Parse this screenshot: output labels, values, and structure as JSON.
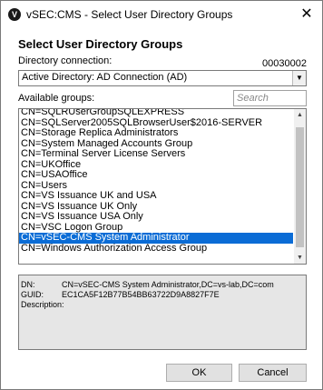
{
  "window": {
    "title": "vSEC:CMS - Select User Directory Groups",
    "close_glyph": "✕"
  },
  "heading": "Select User Directory Groups",
  "directory": {
    "label": "Directory connection:",
    "count": "00030002",
    "selected": "Active Directory: AD Connection (AD)"
  },
  "groups": {
    "label": "Available groups:",
    "search_placeholder": "Search",
    "items": [
      "CN=SQLRUserGroupSQLEXPRESS",
      "CN=SQLServer2005SQLBrowserUser$2016-SERVER",
      "CN=Storage Replica Administrators",
      "CN=System Managed Accounts Group",
      "CN=Terminal Server License Servers",
      "CN=UKOffice",
      "CN=USAOffice",
      "CN=Users",
      "CN=VS Issuance UK and USA",
      "CN=VS Issuance UK Only",
      "CN=VS Issuance USA Only",
      "CN=VSC Logon Group",
      "CN=vSEC-CMS System Administrator",
      "CN=Windows Authorization Access Group"
    ],
    "selected_index": 12
  },
  "details": {
    "dn_label": "DN:",
    "dn_value": "CN=vSEC-CMS System Administrator,DC=vs-lab,DC=com",
    "guid_label": "GUID:",
    "guid_value": "EC1CA5F12B77B54BB63722D9A8827F7E",
    "description_label": "Description:"
  },
  "buttons": {
    "ok": "OK",
    "cancel": "Cancel"
  }
}
